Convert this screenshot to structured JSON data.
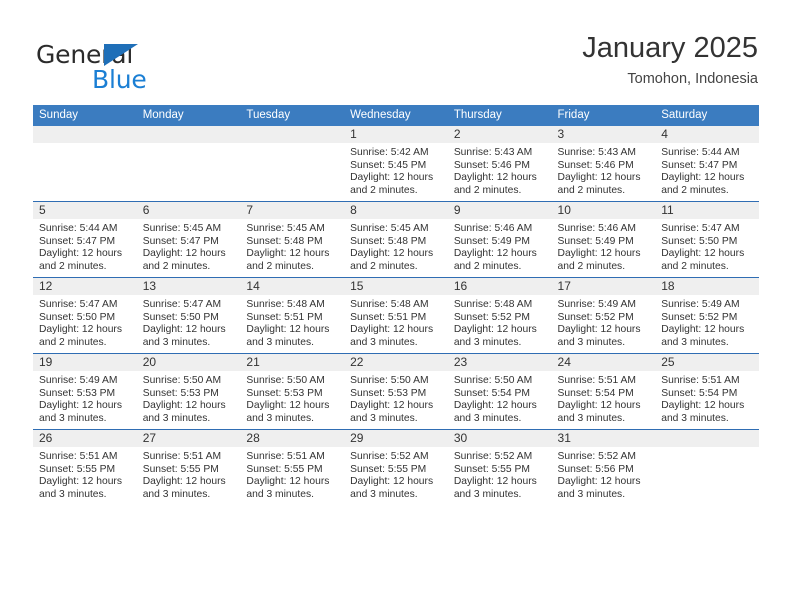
{
  "brand": {
    "name_top": "General",
    "name_bottom": "Blue",
    "triangle_color": "#1f6fb8",
    "blue_text_color": "#1b7fd4"
  },
  "header": {
    "title": "January 2025",
    "subtitle": "Tomohon, Indonesia"
  },
  "theme": {
    "header_row_bg": "#3b7cc0",
    "week_divider": "#2f6db3",
    "daynum_bg": "#efefef",
    "text": "#333333"
  },
  "weekday_headers": [
    "Sunday",
    "Monday",
    "Tuesday",
    "Wednesday",
    "Thursday",
    "Friday",
    "Saturday"
  ],
  "weeks": [
    [
      {
        "day": "",
        "sunrise": "",
        "sunset": "",
        "daylight_line1": "",
        "daylight_line2": "",
        "empty": true
      },
      {
        "day": "",
        "sunrise": "",
        "sunset": "",
        "daylight_line1": "",
        "daylight_line2": "",
        "empty": true
      },
      {
        "day": "",
        "sunrise": "",
        "sunset": "",
        "daylight_line1": "",
        "daylight_line2": "",
        "empty": true
      },
      {
        "day": "1",
        "sunrise": "Sunrise: 5:42 AM",
        "sunset": "Sunset: 5:45 PM",
        "daylight_line1": "Daylight: 12 hours",
        "daylight_line2": "and 2 minutes."
      },
      {
        "day": "2",
        "sunrise": "Sunrise: 5:43 AM",
        "sunset": "Sunset: 5:46 PM",
        "daylight_line1": "Daylight: 12 hours",
        "daylight_line2": "and 2 minutes."
      },
      {
        "day": "3",
        "sunrise": "Sunrise: 5:43 AM",
        "sunset": "Sunset: 5:46 PM",
        "daylight_line1": "Daylight: 12 hours",
        "daylight_line2": "and 2 minutes."
      },
      {
        "day": "4",
        "sunrise": "Sunrise: 5:44 AM",
        "sunset": "Sunset: 5:47 PM",
        "daylight_line1": "Daylight: 12 hours",
        "daylight_line2": "and 2 minutes."
      }
    ],
    [
      {
        "day": "5",
        "sunrise": "Sunrise: 5:44 AM",
        "sunset": "Sunset: 5:47 PM",
        "daylight_line1": "Daylight: 12 hours",
        "daylight_line2": "and 2 minutes."
      },
      {
        "day": "6",
        "sunrise": "Sunrise: 5:45 AM",
        "sunset": "Sunset: 5:47 PM",
        "daylight_line1": "Daylight: 12 hours",
        "daylight_line2": "and 2 minutes."
      },
      {
        "day": "7",
        "sunrise": "Sunrise: 5:45 AM",
        "sunset": "Sunset: 5:48 PM",
        "daylight_line1": "Daylight: 12 hours",
        "daylight_line2": "and 2 minutes."
      },
      {
        "day": "8",
        "sunrise": "Sunrise: 5:45 AM",
        "sunset": "Sunset: 5:48 PM",
        "daylight_line1": "Daylight: 12 hours",
        "daylight_line2": "and 2 minutes."
      },
      {
        "day": "9",
        "sunrise": "Sunrise: 5:46 AM",
        "sunset": "Sunset: 5:49 PM",
        "daylight_line1": "Daylight: 12 hours",
        "daylight_line2": "and 2 minutes."
      },
      {
        "day": "10",
        "sunrise": "Sunrise: 5:46 AM",
        "sunset": "Sunset: 5:49 PM",
        "daylight_line1": "Daylight: 12 hours",
        "daylight_line2": "and 2 minutes."
      },
      {
        "day": "11",
        "sunrise": "Sunrise: 5:47 AM",
        "sunset": "Sunset: 5:50 PM",
        "daylight_line1": "Daylight: 12 hours",
        "daylight_line2": "and 2 minutes."
      }
    ],
    [
      {
        "day": "12",
        "sunrise": "Sunrise: 5:47 AM",
        "sunset": "Sunset: 5:50 PM",
        "daylight_line1": "Daylight: 12 hours",
        "daylight_line2": "and 2 minutes."
      },
      {
        "day": "13",
        "sunrise": "Sunrise: 5:47 AM",
        "sunset": "Sunset: 5:50 PM",
        "daylight_line1": "Daylight: 12 hours",
        "daylight_line2": "and 3 minutes."
      },
      {
        "day": "14",
        "sunrise": "Sunrise: 5:48 AM",
        "sunset": "Sunset: 5:51 PM",
        "daylight_line1": "Daylight: 12 hours",
        "daylight_line2": "and 3 minutes."
      },
      {
        "day": "15",
        "sunrise": "Sunrise: 5:48 AM",
        "sunset": "Sunset: 5:51 PM",
        "daylight_line1": "Daylight: 12 hours",
        "daylight_line2": "and 3 minutes."
      },
      {
        "day": "16",
        "sunrise": "Sunrise: 5:48 AM",
        "sunset": "Sunset: 5:52 PM",
        "daylight_line1": "Daylight: 12 hours",
        "daylight_line2": "and 3 minutes."
      },
      {
        "day": "17",
        "sunrise": "Sunrise: 5:49 AM",
        "sunset": "Sunset: 5:52 PM",
        "daylight_line1": "Daylight: 12 hours",
        "daylight_line2": "and 3 minutes."
      },
      {
        "day": "18",
        "sunrise": "Sunrise: 5:49 AM",
        "sunset": "Sunset: 5:52 PM",
        "daylight_line1": "Daylight: 12 hours",
        "daylight_line2": "and 3 minutes."
      }
    ],
    [
      {
        "day": "19",
        "sunrise": "Sunrise: 5:49 AM",
        "sunset": "Sunset: 5:53 PM",
        "daylight_line1": "Daylight: 12 hours",
        "daylight_line2": "and 3 minutes."
      },
      {
        "day": "20",
        "sunrise": "Sunrise: 5:50 AM",
        "sunset": "Sunset: 5:53 PM",
        "daylight_line1": "Daylight: 12 hours",
        "daylight_line2": "and 3 minutes."
      },
      {
        "day": "21",
        "sunrise": "Sunrise: 5:50 AM",
        "sunset": "Sunset: 5:53 PM",
        "daylight_line1": "Daylight: 12 hours",
        "daylight_line2": "and 3 minutes."
      },
      {
        "day": "22",
        "sunrise": "Sunrise: 5:50 AM",
        "sunset": "Sunset: 5:53 PM",
        "daylight_line1": "Daylight: 12 hours",
        "daylight_line2": "and 3 minutes."
      },
      {
        "day": "23",
        "sunrise": "Sunrise: 5:50 AM",
        "sunset": "Sunset: 5:54 PM",
        "daylight_line1": "Daylight: 12 hours",
        "daylight_line2": "and 3 minutes."
      },
      {
        "day": "24",
        "sunrise": "Sunrise: 5:51 AM",
        "sunset": "Sunset: 5:54 PM",
        "daylight_line1": "Daylight: 12 hours",
        "daylight_line2": "and 3 minutes."
      },
      {
        "day": "25",
        "sunrise": "Sunrise: 5:51 AM",
        "sunset": "Sunset: 5:54 PM",
        "daylight_line1": "Daylight: 12 hours",
        "daylight_line2": "and 3 minutes."
      }
    ],
    [
      {
        "day": "26",
        "sunrise": "Sunrise: 5:51 AM",
        "sunset": "Sunset: 5:55 PM",
        "daylight_line1": "Daylight: 12 hours",
        "daylight_line2": "and 3 minutes."
      },
      {
        "day": "27",
        "sunrise": "Sunrise: 5:51 AM",
        "sunset": "Sunset: 5:55 PM",
        "daylight_line1": "Daylight: 12 hours",
        "daylight_line2": "and 3 minutes."
      },
      {
        "day": "28",
        "sunrise": "Sunrise: 5:51 AM",
        "sunset": "Sunset: 5:55 PM",
        "daylight_line1": "Daylight: 12 hours",
        "daylight_line2": "and 3 minutes."
      },
      {
        "day": "29",
        "sunrise": "Sunrise: 5:52 AM",
        "sunset": "Sunset: 5:55 PM",
        "daylight_line1": "Daylight: 12 hours",
        "daylight_line2": "and 3 minutes."
      },
      {
        "day": "30",
        "sunrise": "Sunrise: 5:52 AM",
        "sunset": "Sunset: 5:55 PM",
        "daylight_line1": "Daylight: 12 hours",
        "daylight_line2": "and 3 minutes."
      },
      {
        "day": "31",
        "sunrise": "Sunrise: 5:52 AM",
        "sunset": "Sunset: 5:56 PM",
        "daylight_line1": "Daylight: 12 hours",
        "daylight_line2": "and 3 minutes."
      },
      {
        "day": "",
        "sunrise": "",
        "sunset": "",
        "daylight_line1": "",
        "daylight_line2": "",
        "empty": true
      }
    ]
  ]
}
